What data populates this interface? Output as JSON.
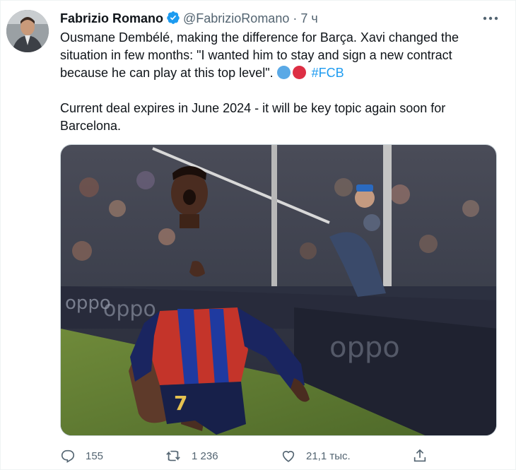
{
  "author": {
    "name": "Fabrizio Romano",
    "handle": "@FabrizioRomano",
    "separator": "·",
    "time": "7 ч"
  },
  "tweet": {
    "line1_text": "Ousmane Dembélé, making the difference for Barça. Xavi changed the situation in few months: \"I wanted him to stay and sign a new contract because he can play at this top level\".",
    "hashtag": "#FCB",
    "line2_text": "Current deal expires in June 2024 - it will be key topic again soon for Barcelona.",
    "emoji_colors": [
      "#5aa9e6",
      "#dd2e44"
    ]
  },
  "media": {
    "board_text": "oppo",
    "jersey_number": "7"
  },
  "actions": {
    "reply_count": "155",
    "retweet_count": "1 236",
    "like_count": "21,1 тыс.",
    "icons": [
      "reply-icon",
      "retweet-icon",
      "like-icon",
      "share-icon"
    ]
  },
  "colors": {
    "link": "#1d9bf0",
    "verified": "#1d9bf0",
    "secondary_text": "#536471"
  }
}
